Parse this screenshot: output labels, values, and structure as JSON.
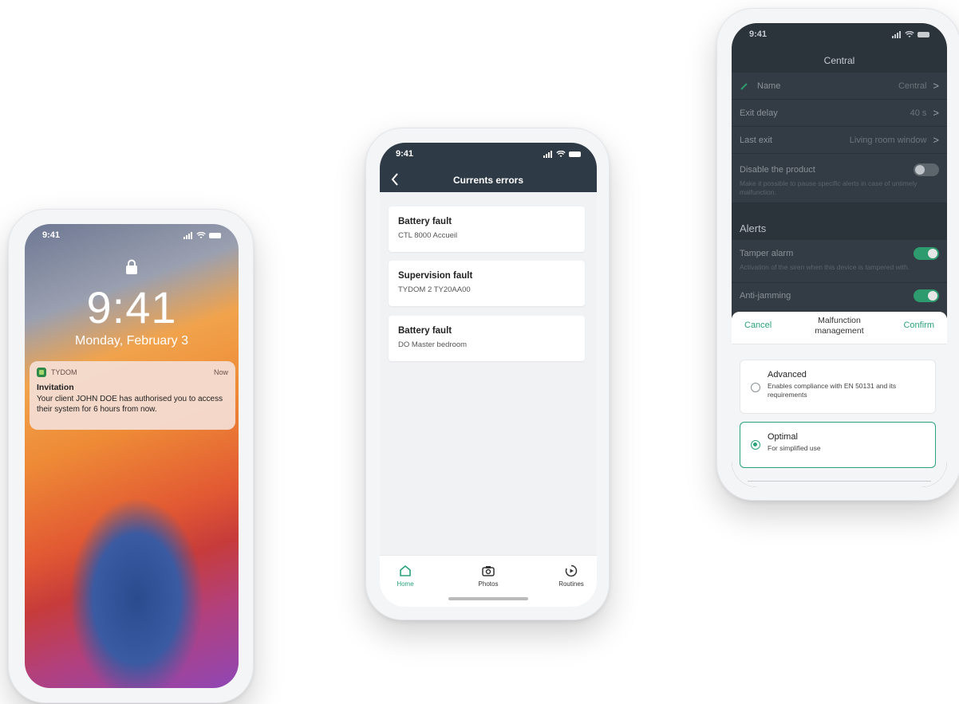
{
  "phone_lock": {
    "status_time": "9:41",
    "time": "9:41",
    "date": "Monday, February 3",
    "notification": {
      "app": "TYDOM",
      "when": "Now",
      "title": "Invitation",
      "body": "Your client JOHN DOE has authorised you to access their system for 6 hours from now."
    }
  },
  "phone_errors": {
    "status_time": "9:41",
    "title": "Currents errors",
    "errors": [
      {
        "title": "Battery fault",
        "subtitle": "CTL 8000 Accueil"
      },
      {
        "title": "Supervision fault",
        "subtitle": "TYDOM 2 TY20AA00"
      },
      {
        "title": "Battery fault",
        "subtitle": "DO Master bedroom"
      }
    ],
    "tabs": [
      {
        "label": "Home",
        "icon": "home-icon"
      },
      {
        "label": "Photos",
        "icon": "camera-icon"
      },
      {
        "label": "Routines",
        "icon": "routines-icon"
      }
    ]
  },
  "phone_central": {
    "status_time": "9:41",
    "title": "Central",
    "rows": {
      "name": {
        "label": "Name",
        "value": "Central"
      },
      "exit_delay": {
        "label": "Exit delay",
        "value": "40 s"
      },
      "last_exit": {
        "label": "Last exit",
        "value": "Living room window"
      },
      "disable": {
        "label": "Disable the product",
        "hint": "Make it possible to pause specific alerts in case of untimely malfunction."
      }
    },
    "alerts_heading": "Alerts",
    "alerts": {
      "tamper": {
        "label": "Tamper alarm",
        "hint": "Activation of the siren when this device is tampered with."
      },
      "jamming": {
        "label": "Anti-jamming"
      }
    },
    "sheet": {
      "cancel": "Cancel",
      "title": "Malfunction management",
      "confirm": "Confirm",
      "options": [
        {
          "title": "Advanced",
          "subtitle": "Enables compliance with EN 50131 and its requirements"
        },
        {
          "title": "Optimal",
          "subtitle": "For simplified use"
        }
      ]
    }
  },
  "colors": {
    "accent": "#2aa37a",
    "dark_header": "#2e3a46"
  }
}
